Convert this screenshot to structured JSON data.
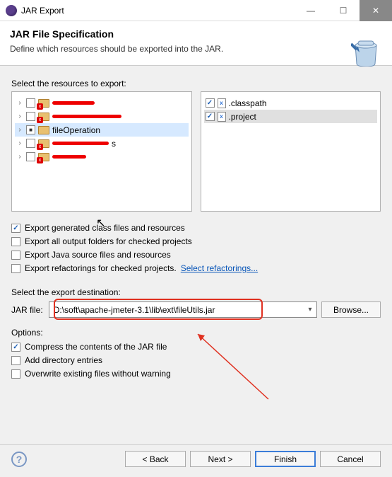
{
  "window": {
    "title": "JAR Export"
  },
  "header": {
    "title": "JAR File Specification",
    "desc": "Define which resources should be exported into the JAR."
  },
  "resources": {
    "label": "Select the resources to export:",
    "tree": [
      {
        "checked": false,
        "err": true,
        "selected": false,
        "redactW": 60,
        "name": ""
      },
      {
        "checked": false,
        "err": true,
        "selected": false,
        "redactW": 98,
        "name": ""
      },
      {
        "checked": "square",
        "err": false,
        "selected": true,
        "redactW": 0,
        "name": "fileOperation"
      },
      {
        "checked": false,
        "err": true,
        "selected": false,
        "redactW": 80,
        "name": "",
        "suffix": "s"
      },
      {
        "checked": false,
        "err": true,
        "selected": false,
        "redactW": 48,
        "name": ""
      }
    ],
    "files": [
      {
        "checked": true,
        "selected": false,
        "name": ".classpath",
        "tag": "x"
      },
      {
        "checked": true,
        "selected": true,
        "name": ".project",
        "tag": "x"
      }
    ]
  },
  "exportOptions": [
    {
      "checked": true,
      "label": "Export generated class files and resources"
    },
    {
      "checked": false,
      "label": "Export all output folders for checked projects"
    },
    {
      "checked": false,
      "label": "Export Java source files and resources"
    },
    {
      "checked": false,
      "label": "Export refactorings for checked projects.",
      "link": "Select refactorings..."
    }
  ],
  "destination": {
    "label": "Select the export destination:",
    "fieldLabel": "JAR file:",
    "value": "D:\\soft\\apache-jmeter-3.1\\lib\\ext\\fileUtils.jar",
    "browse": "Browse..."
  },
  "optionsTitle": "Options:",
  "jarOptions": [
    {
      "checked": true,
      "label": "Compress the contents of the JAR file"
    },
    {
      "checked": false,
      "label": "Add directory entries"
    },
    {
      "checked": false,
      "label": "Overwrite existing files without warning"
    }
  ],
  "footer": {
    "back": "< Back",
    "next": "Next >",
    "finish": "Finish",
    "cancel": "Cancel"
  }
}
